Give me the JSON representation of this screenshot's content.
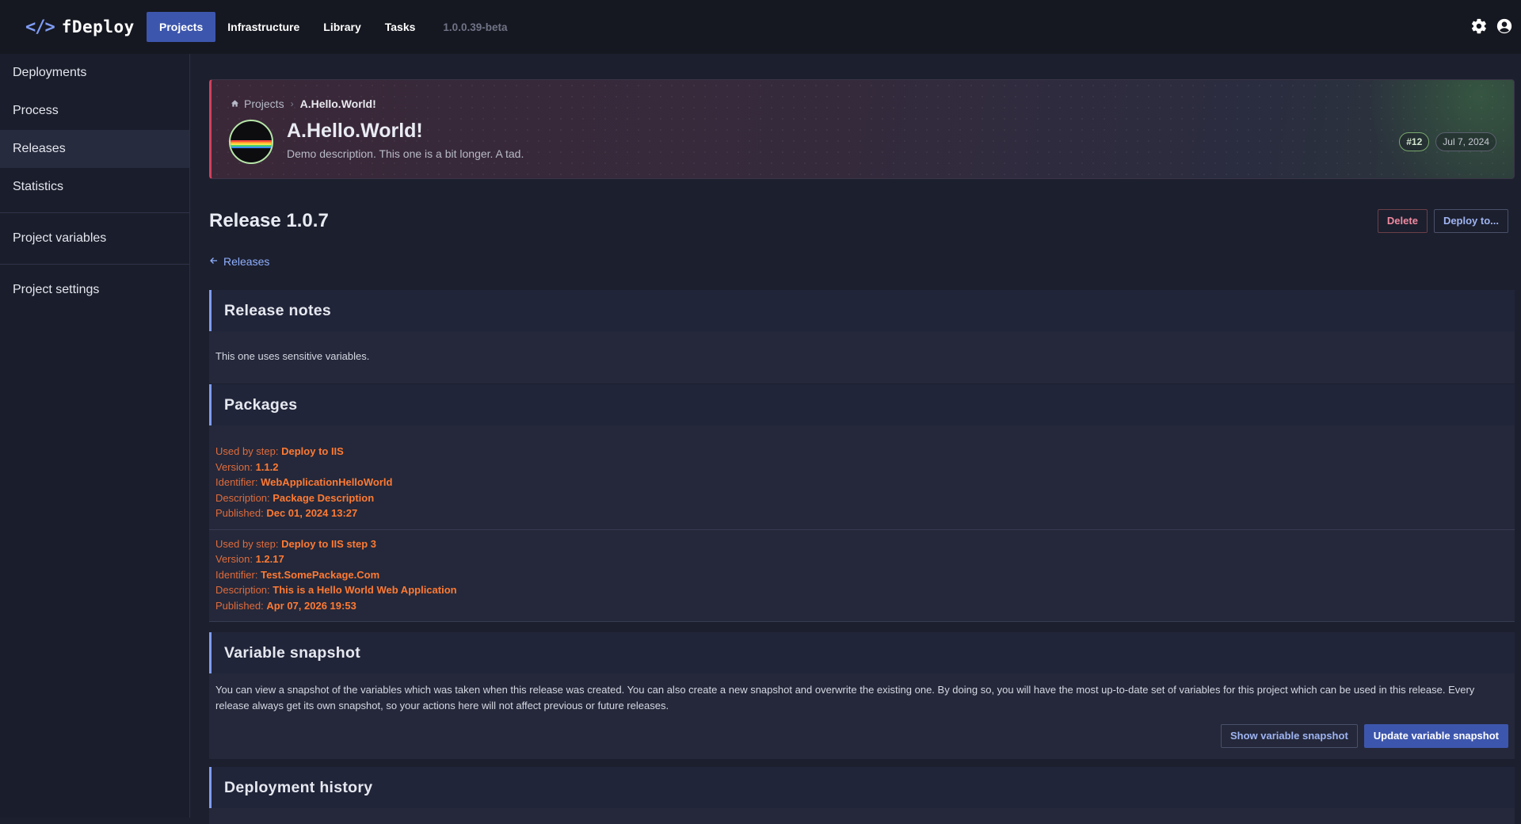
{
  "app": {
    "name": "fDeploy",
    "logo_mark": "</>",
    "version": "1.0.0.39-beta"
  },
  "nav": [
    {
      "label": "Projects",
      "active": true
    },
    {
      "label": "Infrastructure",
      "active": false
    },
    {
      "label": "Library",
      "active": false
    },
    {
      "label": "Tasks",
      "active": false
    }
  ],
  "top_icons": [
    "gear-icon",
    "user-circle-icon"
  ],
  "sidebar": {
    "items": [
      {
        "label": "Deployments"
      },
      {
        "label": "Process"
      },
      {
        "label": "Releases",
        "active": true
      },
      {
        "label": "Statistics"
      },
      {
        "label": "Project variables"
      },
      {
        "label": "Project settings"
      }
    ]
  },
  "project": {
    "breadcrumb_root": "Projects",
    "breadcrumb_current": "A.Hello.World!",
    "title": "A.Hello.World!",
    "description": "Demo description. This one is a bit longer. A tad.",
    "badge_number": "#12",
    "badge_date": "Jul 7, 2024"
  },
  "release": {
    "title": "Release 1.0.7",
    "delete_label": "Delete",
    "deploy_label": "Deploy to...",
    "back_label": "Releases"
  },
  "notes": {
    "heading": "Release notes",
    "text": "This one uses sensitive variables."
  },
  "packages": {
    "heading": "Packages",
    "labels": {
      "step": "Used by step: ",
      "version": "Version: ",
      "identifier": "Identifier: ",
      "description": "Description: ",
      "published": "Published: "
    },
    "items": [
      {
        "step": "Deploy to IIS",
        "version": "1.1.2",
        "identifier": "WebApplicationHelloWorld",
        "description": "Package Description",
        "published": "Dec 01, 2024 13:27"
      },
      {
        "step": "Deploy to IIS step 3",
        "version": "1.2.17",
        "identifier": "Test.SomePackage.Com",
        "description": "This is a Hello World Web Application",
        "published": "Apr 07, 2026 19:53"
      }
    ]
  },
  "snapshot": {
    "heading": "Variable snapshot",
    "text": "You can view a snapshot of the variables which was taken when this release was created. You can also create a new snapshot and overwrite the existing one. By doing so, you will have the most up-to-date set of variables for this project which can be used in this release. Every release always get its own snapshot, so your actions here will not affect previous or future releases.",
    "show_label": "Show variable snapshot",
    "update_label": "Update variable snapshot"
  },
  "history": {
    "heading": "Deployment history"
  },
  "colors": {
    "accent": "#3d56ad",
    "section_border": "#7f9cf5",
    "hero_border": "#d1405e",
    "package_value": "#ff7a33",
    "link": "#8fb0ff"
  }
}
